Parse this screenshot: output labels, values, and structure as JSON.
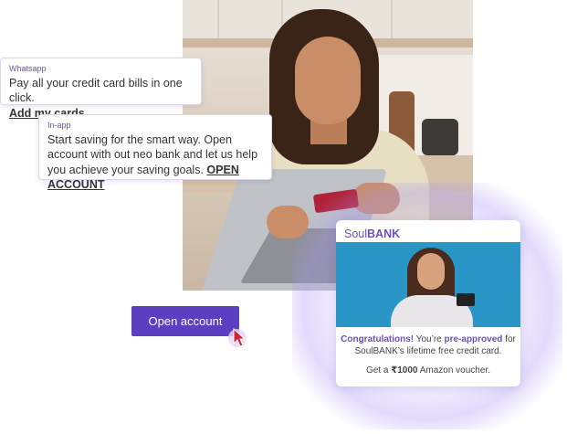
{
  "notifications": {
    "whatsapp": {
      "label": "Whatsapp",
      "text": "Pay all your credit card bills in one click.",
      "link": "Add my cards"
    },
    "inapp": {
      "label": "In-app",
      "text": "Start saving for the smart way. Open account with out neo bank and let us help you achieve your saving goals.",
      "link": "OPEN ACCOUNT"
    }
  },
  "bank_card": {
    "brand_light": "Soul",
    "brand_bold": "BANK",
    "congrats_bold": "Congratulations!",
    "congrats_text": " You’re ",
    "preapproved": "pre-approved",
    "congrats_tail": " for SoulBANK’s lifetime free credit card.",
    "voucher_prefix": "Get a ",
    "voucher_amount": "₹1000",
    "voucher_suffix": " Amazon voucher."
  },
  "cta": {
    "label": "Open account"
  },
  "colors": {
    "accent": "#5b3fc0",
    "brand": "#6b4fc7"
  },
  "icons": {
    "cursor": "pointer-cursor-icon"
  }
}
